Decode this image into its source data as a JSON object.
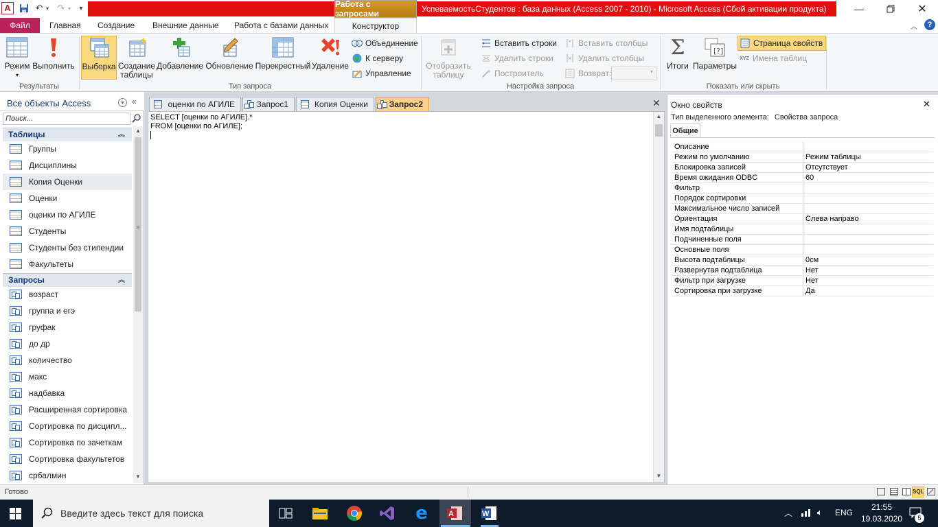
{
  "window": {
    "context_tab": "Работа с запросами",
    "title": "УспеваемостьСтудентов : база данных (Access 2007 - 2010)  -  Microsoft Access (Сбой активации продукта)",
    "app_letter": "A"
  },
  "ribbon_tabs": [
    "Файл",
    "Главная",
    "Создание",
    "Внешние данные",
    "Работа с базами данных",
    "Конструктор"
  ],
  "ribbon": {
    "results": {
      "label": "Результаты",
      "mode": "Режим",
      "run": "Выполнить"
    },
    "query_type": {
      "label": "Тип запроса",
      "select": "Выборка",
      "make_table_1": "Создание",
      "make_table_2": "таблицы",
      "append": "Добавление",
      "update": "Обновление",
      "crosstab": "Перекрестный",
      "delete": "Удаление",
      "union": "Объединение",
      "pass_through": "К серверу",
      "data_definition": "Управление"
    },
    "setup": {
      "label": "Настройка запроса",
      "show_table_1": "Отобразить",
      "show_table_2": "таблицу",
      "insert_rows": "Вставить строки",
      "delete_rows": "Удалить строки",
      "builder": "Построитель",
      "insert_columns": "Вставить столбцы",
      "delete_columns": "Удалить столбцы",
      "return": "Возврат:"
    },
    "show_hide": {
      "label": "Показать или скрыть",
      "totals": "Итоги",
      "parameters": "Параметры",
      "property_sheet": "Страница свойств",
      "table_names": "Имена таблиц"
    }
  },
  "nav": {
    "title": "Все объекты Access",
    "search_placeholder": "Поиск...",
    "tables_header": "Таблицы",
    "tables": [
      "Группы",
      "Дисциплины",
      "Копия Оценки",
      "Оценки",
      "оценки по АГИЛЕ",
      "Студенты",
      "Студенты без стипендии",
      "Факультеты"
    ],
    "queries_header": "Запросы",
    "queries": [
      "возраст",
      "группа и егэ",
      "груфак",
      "до др",
      "количество",
      "макс",
      "надбавка",
      "Расширенная сортировка",
      "Сортировка по дисципл...",
      "Сортировка по зачеткам",
      "Сортировка факультетов",
      "србалмин"
    ]
  },
  "doc_tabs": [
    "оценки по АГИЛЕ",
    "Запрос1",
    "Копия Оценки",
    "Запрос2"
  ],
  "editor": {
    "sql_line1": "SELECT [оценки по АГИЛЕ].*",
    "sql_line2": "FROM [оценки по АГИЛЕ];"
  },
  "properties": {
    "title": "Окно свойств",
    "selection_type_label": "Тип выделенного элемента:",
    "selection_type_value": "Свойства запроса",
    "tab": "Общие",
    "rows": [
      {
        "name": "Описание",
        "value": ""
      },
      {
        "name": "Режим по умолчанию",
        "value": "Режим таблицы"
      },
      {
        "name": "Блокировка записей",
        "value": "Отсутствует"
      },
      {
        "name": "Время ожидания ODBC",
        "value": "60"
      },
      {
        "name": "Фильтр",
        "value": ""
      },
      {
        "name": "Порядок сортировки",
        "value": ""
      },
      {
        "name": "Максимальное число записей",
        "value": ""
      },
      {
        "name": "Ориентация",
        "value": "Слева направо"
      },
      {
        "name": "Имя подтаблицы",
        "value": ""
      },
      {
        "name": "Подчиненные поля",
        "value": ""
      },
      {
        "name": "Основные поля",
        "value": ""
      },
      {
        "name": "Высота подтаблицы",
        "value": "0см"
      },
      {
        "name": "Развернутая подтаблица",
        "value": "Нет"
      },
      {
        "name": "Фильтр при загрузке",
        "value": "Нет"
      },
      {
        "name": "Сортировка при загрузке",
        "value": "Да"
      }
    ]
  },
  "status": {
    "text": "Готово",
    "sql_badge": "SQL"
  },
  "taskbar": {
    "search_placeholder": "Введите здесь текст для поиска",
    "lang": "ENG",
    "time": "21:55",
    "date": "19.03.2020",
    "notif_count": "5"
  }
}
